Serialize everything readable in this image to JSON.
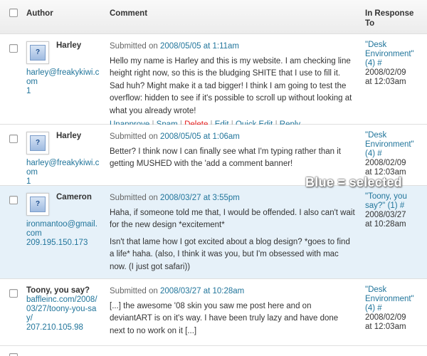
{
  "header": {
    "author": "Author",
    "comment": "Comment",
    "in_response_to": "In Response To"
  },
  "comments": [
    {
      "name": "Harley",
      "email": "harley@freakykiwi.com",
      "extra": "1",
      "avatar_glyph": "?",
      "submitted_label": "Submitted on",
      "date": "2008/05/05 at 1:11am",
      "paragraphs": [
        "Hello my name is Harley and this is my website. I am checking line height right now, so this is the bludging SHITE that I use to fill it. Sad huh? Might make it a tad bigger! I think I am going to test the overflow: hidden to see if it's possible to scroll up without looking at what you already wrote!"
      ],
      "actions": [
        "Unapprove",
        "Spam",
        "Delete",
        "Edit",
        "Quick Edit",
        "Reply"
      ],
      "response_post": "\"Desk Environment\" (4) #",
      "response_date": "2008/02/09",
      "response_time": "at 12:03am",
      "selected": false
    },
    {
      "name": "Harley",
      "email": "harley@freakykiwi.com",
      "extra": "1",
      "avatar_glyph": "?",
      "submitted_label": "Submitted on",
      "date": "2008/05/05 at 1:06am",
      "paragraphs": [
        "Better? I think now I can finally see what I'm typing rather than it getting MUSHED with the 'add a comment banner!"
      ],
      "response_post": "\"Desk Environment\" (4) #",
      "response_date": "2008/02/09",
      "response_time": "at 12:03am",
      "selected": false
    },
    {
      "name": "Cameron",
      "email": "ironmantoo@gmail.com",
      "extra": "209.195.150.173",
      "avatar_glyph": "?",
      "submitted_label": "Submitted on",
      "date": "2008/03/27 at 3:55pm",
      "paragraphs": [
        "Haha, if someone told me that, I would be offended. I also can't wait for the new design *excitement*",
        "Isn't that lame how I got excited about a blog design? *goes to find a life* haha. (also, I think it was you, but I'm obsessed with mac now. (I just got safari))"
      ],
      "response_post": "\"Toony, you say?\" (1) #",
      "response_date": "2008/03/27",
      "response_time": "at 10:28am",
      "selected": true
    },
    {
      "name": "Toony, you say?",
      "email": "baffleinc.com/2008/03/27/toony-you-say/",
      "extra": "207.210.105.98",
      "submitted_label": "Submitted on",
      "date": "2008/03/27 at 10:28am",
      "paragraphs": [
        "[...] the awesome '08 skin you saw me post here and on deviantART is on it's way. I have been truly lazy and have done next to no work on it [...]"
      ],
      "response_post": "\"Desk Environment\" (4) #",
      "response_date": "2008/02/09",
      "response_time": "at 12:03am",
      "selected": false
    }
  ],
  "overlay_note": "Blue = selected",
  "colors": {
    "link": "#21759b",
    "delete": "#e41d1d",
    "selected_bg": "#e6f1f9"
  }
}
